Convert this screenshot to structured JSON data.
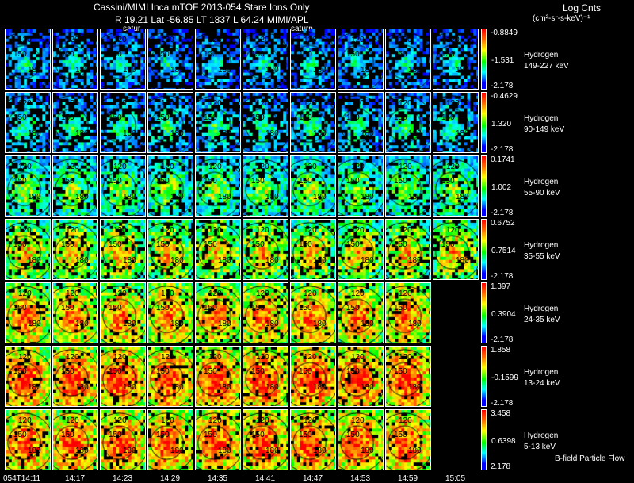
{
  "header": {
    "line1": "Cassini/MIMI Inca mTOF  2013-054   Stare   Ions Only",
    "line2": "R        19.21 Lat -56.85 LT 1837 L        64.24  MIMI/APL",
    "saturn_labels": [
      "satur",
      "saturn"
    ],
    "legend_title": "Log Cnts",
    "legend_units": "(cm²-sr-s-keV)⁻¹"
  },
  "footer_note": "B-field Particle Flow",
  "time_labels": [
    "054T14:11",
    "14:17",
    "14:23",
    "14:29",
    "14:35",
    "14:41",
    "14:47",
    "14:53",
    "14:59",
    "15:05"
  ],
  "contour_labels": [
    "120",
    "150",
    "180"
  ],
  "colors": {
    "high": "#ff0000",
    "mid": "#00ff00",
    "low": "#0000ff",
    "background": "#000000"
  },
  "chart_data": {
    "type": "heatmap",
    "title": "Cassini/MIMI Inca mTOF  2013-054   Stare   Ions Only",
    "rows": [
      {
        "species": "Hydrogen",
        "energy": "149-227 keV",
        "cb_max": "-0.8849",
        "cb_mid": "-1.531",
        "cb_min": "-2.178",
        "panels": 10,
        "level": 0.22
      },
      {
        "species": "Hydrogen",
        "energy": "90-149 keV",
        "cb_max": "-0.4629",
        "cb_mid": "1.320",
        "cb_min": "-2.178",
        "panels": 10,
        "level": 0.3
      },
      {
        "species": "Hydrogen",
        "energy": "55-90 keV",
        "cb_max": "0.1741",
        "cb_mid": "1.002",
        "cb_min": "-2.178",
        "panels": 10,
        "level": 0.45
      },
      {
        "species": "Hydrogen",
        "energy": "35-55 keV",
        "cb_max": "0.6752",
        "cb_mid": "0.7514",
        "cb_min": "-2.178",
        "panels": 10,
        "level": 0.62
      },
      {
        "species": "Hydrogen",
        "energy": "24-35 keV",
        "cb_max": "1.397",
        "cb_mid": "0.3904",
        "cb_min": "-2.178",
        "panels": 9,
        "level": 0.72
      },
      {
        "species": "Hydrogen",
        "energy": "13-24 keV",
        "cb_max": "1.858",
        "cb_mid": "-0.1599",
        "cb_min": "-2.178",
        "panels": 9,
        "level": 0.8
      },
      {
        "species": "Hydrogen",
        "energy": "5-13 keV",
        "cb_max": "3.458",
        "cb_mid": "0.6398",
        "cb_min": "2.178",
        "panels": 9,
        "level": 0.78
      }
    ]
  }
}
